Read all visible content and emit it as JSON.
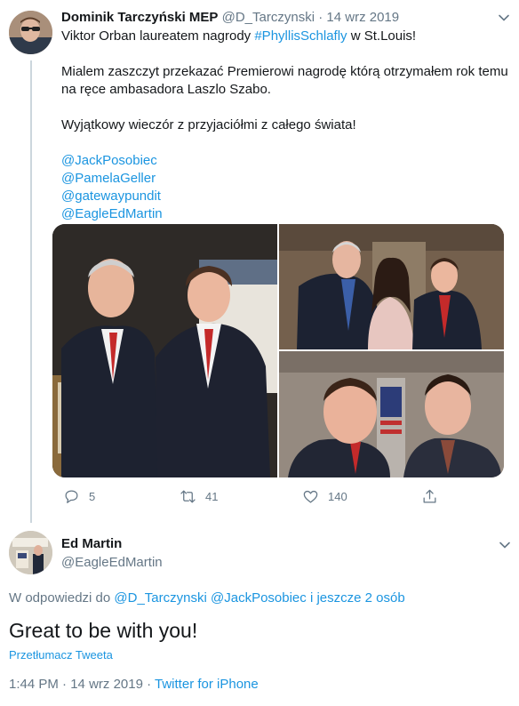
{
  "tweet": {
    "author_name": "Dominik Tarczyński MEP",
    "handle": "@D_Tarczynski",
    "separator": "·",
    "date": "14 wrz 2019",
    "line1_pre": "Viktor Orban laureatem nagrody ",
    "line1_hashtag": "#PhyllisSchlafly",
    "line1_post": " w St.Louis!",
    "paragraph2": "Mialem zaszczyt przekazać Premierowi nagrodę którą otrzymałem rok temu na ręce ambasadora Laszlo Szabo.",
    "paragraph3": "Wyjątkowy wieczór z przyjaciółmi z całego świata!",
    "mentions": [
      "@JackPosobiec",
      "@PamelaGeller",
      "@gatewaypundit",
      "@EagleEdMartin"
    ],
    "media_count": 3,
    "reply_count": "5",
    "retweet_count": "41",
    "like_count": "140"
  },
  "reply": {
    "author_name": "Ed Martin",
    "handle": "@EagleEdMartin",
    "replying_to_prefix": "W odpowiedzi do ",
    "replying_to_user1": "@D_Tarczynski",
    "replying_to_user2": "@JackPosobiec",
    "replying_to_more": "i jeszcze 2 osób",
    "text": "Great to be with you!",
    "translate_label": "Przetłumacz Tweeta",
    "time": "1:44 PM",
    "date": "14 wrz 2019",
    "source": "Twitter for iPhone"
  },
  "icons": {
    "reply": "reply-icon",
    "retweet": "retweet-icon",
    "like": "like-icon",
    "share": "share-icon",
    "menu": "chevron-down-icon"
  },
  "colors": {
    "link": "#1b95e0",
    "muted": "#657786",
    "text": "#14171a",
    "thread_line": "#ccd6dd"
  }
}
